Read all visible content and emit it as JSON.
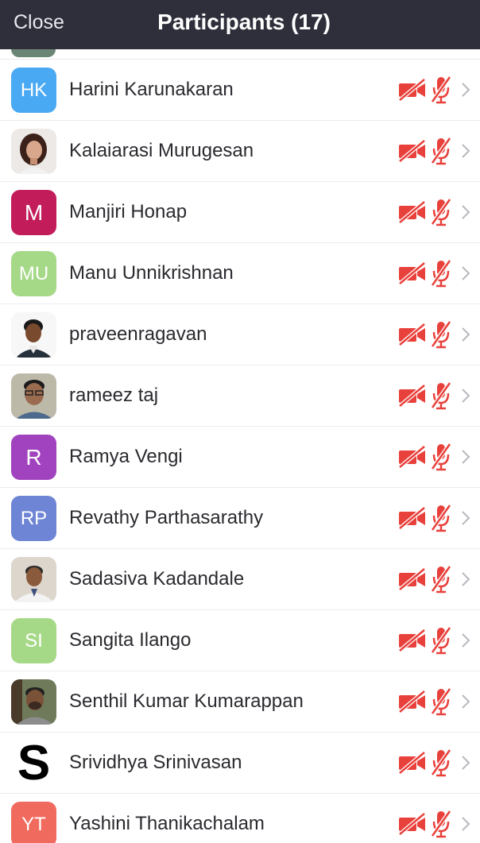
{
  "header": {
    "close_label": "Close",
    "title": "Participants (17)"
  },
  "colors": {
    "header_bg": "#2f2f3b",
    "muted_red": "#e8413c",
    "chevron": "#b8b8c0"
  },
  "participants": [
    {
      "name": "Harini Karunakaran",
      "initials": "HK",
      "avatar": "initials",
      "color": "#4aa9f3"
    },
    {
      "name": "Kalaiarasi Murugesan",
      "initials": "",
      "avatar": "photo-woman"
    },
    {
      "name": "Manjiri Honap",
      "initials": "M",
      "avatar": "initials",
      "color": "#c21c5a"
    },
    {
      "name": "Manu Unnikrishnan",
      "initials": "MU",
      "avatar": "initials",
      "color": "#a6d987"
    },
    {
      "name": "praveenragavan",
      "initials": "",
      "avatar": "photo-man"
    },
    {
      "name": "rameez taj",
      "initials": "",
      "avatar": "photo-man-glasses"
    },
    {
      "name": "Ramya Vengi",
      "initials": "R",
      "avatar": "initials",
      "color": "#a142bf"
    },
    {
      "name": "Revathy Parthasarathy",
      "initials": "RP",
      "avatar": "initials",
      "color": "#6e85d6"
    },
    {
      "name": "Sadasiva Kadandale",
      "initials": "",
      "avatar": "photo-doctor"
    },
    {
      "name": "Sangita Ilango",
      "initials": "SI",
      "avatar": "initials",
      "color": "#a6d987"
    },
    {
      "name": "Senthil Kumar Kumarappan",
      "initials": "",
      "avatar": "photo-man-beard"
    },
    {
      "name": "Srividhya Srinivasan",
      "initials": "S",
      "avatar": "big-letter"
    },
    {
      "name": "Yashini Thanikachalam",
      "initials": "YT",
      "avatar": "initials",
      "color": "#f06a5e"
    }
  ]
}
